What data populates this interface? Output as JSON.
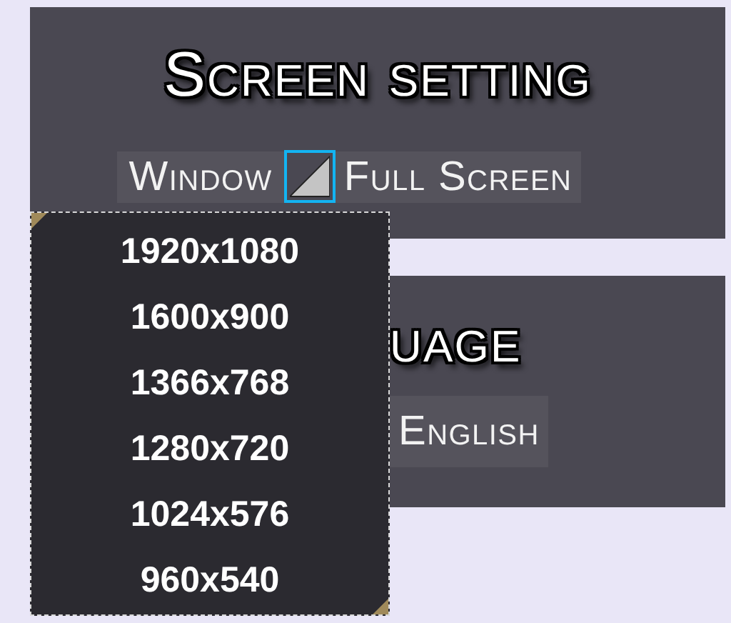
{
  "screen_panel": {
    "title": "Screen setting",
    "window_button": "Window",
    "fullscreen_toggle": {
      "on": true
    },
    "fullscreen_button": "Full Screen"
  },
  "language_panel": {
    "title": "uage",
    "language_button": "English"
  },
  "resolution_dropdown": {
    "options": [
      {
        "label": "1920x1080"
      },
      {
        "label": "1600x900"
      },
      {
        "label": "1366x768"
      },
      {
        "label": "1280x720"
      },
      {
        "label": "1024x576"
      },
      {
        "label": "960x540"
      }
    ]
  }
}
